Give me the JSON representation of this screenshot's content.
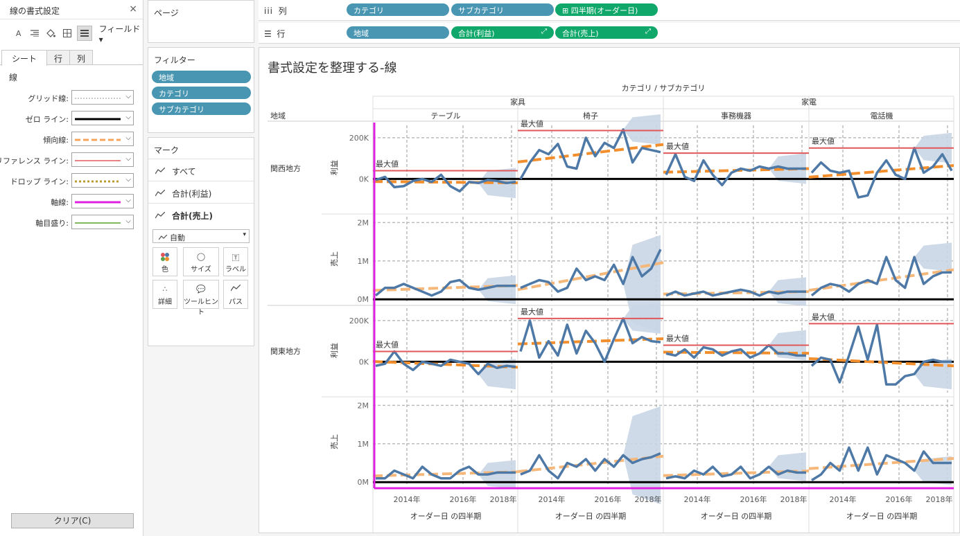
{
  "format_pane": {
    "title": "線の書式設定",
    "close": "×",
    "toolbar_field": "フィールド▾",
    "tabs": [
      {
        "label": "シート",
        "active": true
      },
      {
        "label": "行",
        "active": false
      },
      {
        "label": "列",
        "active": false
      }
    ],
    "section": "線",
    "rows": [
      {
        "label": "グリッド線:",
        "style": "dotted",
        "color": "#bbbbbb"
      },
      {
        "label": "ゼロ ライン:",
        "style": "solid-thick",
        "color": "#000000"
      },
      {
        "label": "傾向線:",
        "style": "dashed",
        "color": "#f5a45d"
      },
      {
        "label": "リファレンス ライン:",
        "style": "solid",
        "color": "#e05a5a"
      },
      {
        "label": "ドロップ ライン:",
        "style": "dotted-thick",
        "color": "#b89b35"
      },
      {
        "label": "軸線:",
        "style": "solid-thick",
        "color": "#e020e0"
      },
      {
        "label": "軸目盛り:",
        "style": "solid",
        "color": "#5aa02c"
      }
    ],
    "clear_button": "クリア(C)"
  },
  "pages": {
    "title": "ページ"
  },
  "filters": {
    "title": "フィルター",
    "items": [
      "地域",
      "カテゴリ",
      "サブカテゴリ"
    ]
  },
  "marks": {
    "title": "マーク",
    "rows": [
      "すべて",
      "合計(利益)",
      "合計(売上)"
    ],
    "type": "自動",
    "buttons": [
      "色",
      "サイズ",
      "ラベル",
      "詳細",
      "ツールヒント",
      "パス"
    ]
  },
  "columns_shelf": {
    "label": "列",
    "pills": [
      "カテゴリ",
      "サブカテゴリ",
      "⊞ 四半期(オーダー日)"
    ]
  },
  "rows_shelf": {
    "label": "行",
    "pills": [
      "地域",
      "合計(利益)",
      "合計(売上)"
    ]
  },
  "viz": {
    "title": "書式設定を整理する-線",
    "col_header_title": "カテゴリ / サブカテゴリ",
    "row_header_title": "地域",
    "categories": [
      "家具",
      "家電"
    ],
    "subcategories": [
      "テーブル",
      "椅子",
      "事務機器",
      "電話機"
    ],
    "regions": [
      "関西地方",
      "関東地方"
    ],
    "measures": [
      "利益",
      "売上"
    ],
    "profit_ticks": [
      "200K",
      "0K"
    ],
    "sales_ticks": [
      "2M",
      "1M",
      "0M"
    ],
    "x_ticks": [
      "2014年",
      "2016年",
      "2018年"
    ],
    "x_title": "オーダー日 の四半期",
    "ref_label": "最大値",
    "colors": {
      "line": "#4e79a7",
      "trend": "#f28e2b",
      "trend_light": "#f5b87a",
      "ref": "#e15759",
      "axis": "#e020e0",
      "band": "#c9d6e6",
      "grid": "#bbbbbb"
    }
  },
  "chart_data": {
    "type": "line",
    "x": [
      "2014年",
      "2016年",
      "2018年"
    ],
    "xlabel": "オーダー日 の四半期",
    "panels": [
      {
        "region": "関西地方",
        "measure": "利益",
        "subcategory": "テーブル",
        "values": [
          -5,
          10,
          -40,
          -35,
          -10,
          0,
          -15,
          20,
          -35,
          -60,
          -15,
          -20,
          -5,
          -10,
          -20,
          -15
        ],
        "reference": 40
      },
      {
        "region": "関西地方",
        "measure": "利益",
        "subcategory": "椅子",
        "values": [
          0,
          80,
          140,
          120,
          170,
          60,
          50,
          200,
          110,
          175,
          150,
          240,
          80,
          150,
          140,
          130
        ],
        "reference": 235
      },
      {
        "region": "関西地方",
        "measure": "利益",
        "subcategory": "事務機器",
        "values": [
          20,
          120,
          10,
          -10,
          90,
          20,
          -30,
          30,
          50,
          40,
          60,
          50,
          60,
          50,
          50,
          50
        ],
        "reference": 125
      },
      {
        "region": "関西地方",
        "measure": "利益",
        "subcategory": "電話機",
        "values": [
          30,
          80,
          40,
          30,
          40,
          -90,
          -80,
          30,
          90,
          20,
          0,
          150,
          30,
          60,
          120,
          40
        ],
        "reference": 150
      },
      {
        "region": "関西地方",
        "measure": "売上",
        "subcategory": "テーブル",
        "values": [
          0.1,
          0.3,
          0.3,
          0.4,
          0.3,
          0.2,
          0.1,
          0.2,
          0.45,
          0.5,
          0.3,
          0.25,
          0.3,
          0.35,
          0.35,
          0.35
        ]
      },
      {
        "region": "関西地方",
        "measure": "売上",
        "subcategory": "椅子",
        "values": [
          0.3,
          0.4,
          0.5,
          0.45,
          0.2,
          0.3,
          0.8,
          0.5,
          0.6,
          0.5,
          0.9,
          0.4,
          1.1,
          0.6,
          0.8,
          1.3
        ]
      },
      {
        "region": "関西地方",
        "measure": "売上",
        "subcategory": "事務機器",
        "values": [
          0.1,
          0.2,
          0.1,
          0.15,
          0.2,
          0.1,
          0.15,
          0.2,
          0.25,
          0.2,
          0.1,
          0.2,
          0.15,
          0.2,
          0.2,
          0.2
        ]
      },
      {
        "region": "関西地方",
        "measure": "売上",
        "subcategory": "電話機",
        "values": [
          0.1,
          0.3,
          0.4,
          0.35,
          0.2,
          0.4,
          0.5,
          0.4,
          1.1,
          0.5,
          0.3,
          1.1,
          0.4,
          0.6,
          0.7,
          0.7
        ]
      },
      {
        "region": "関東地方",
        "measure": "利益",
        "subcategory": "テーブル",
        "values": [
          -20,
          -10,
          50,
          -10,
          -40,
          0,
          -10,
          -20,
          10,
          0,
          -10,
          -60,
          -10,
          -30,
          -20,
          -25
        ],
        "reference": 50
      },
      {
        "region": "関東地方",
        "measure": "利益",
        "subcategory": "椅子",
        "values": [
          50,
          200,
          20,
          100,
          30,
          180,
          40,
          150,
          90,
          0,
          110,
          210,
          90,
          120,
          100,
          95
        ],
        "reference": 210
      },
      {
        "region": "関東地方",
        "measure": "利益",
        "subcategory": "事務機器",
        "values": [
          40,
          30,
          60,
          20,
          70,
          60,
          30,
          50,
          60,
          20,
          40,
          80,
          40,
          40,
          30,
          30
        ],
        "reference": 80
      },
      {
        "region": "関東地方",
        "measure": "利益",
        "subcategory": "電話機",
        "values": [
          -20,
          20,
          10,
          -100,
          30,
          170,
          10,
          180,
          -110,
          -110,
          -70,
          -60,
          0,
          10,
          0,
          0
        ],
        "reference": 185
      },
      {
        "region": "関東地方",
        "measure": "売上",
        "subcategory": "テーブル",
        "values": [
          0.1,
          0.1,
          0.3,
          0.2,
          0.1,
          0.4,
          0.2,
          0.1,
          0.1,
          0.3,
          0.4,
          0.2,
          0.2,
          0.25,
          0.25,
          0.25
        ]
      },
      {
        "region": "関東地方",
        "measure": "売上",
        "subcategory": "椅子",
        "values": [
          0.2,
          0.3,
          0.7,
          0.3,
          0.1,
          0.5,
          0.4,
          0.6,
          0.3,
          0.6,
          0.4,
          0.7,
          0.5,
          0.6,
          0.65,
          0.75
        ]
      },
      {
        "region": "関東地方",
        "measure": "売上",
        "subcategory": "事務機器",
        "values": [
          0.1,
          0.15,
          0.1,
          0.3,
          0.2,
          0.4,
          0.15,
          0.2,
          0.4,
          0.1,
          0.2,
          0.4,
          0.2,
          0.3,
          0.25,
          0.25
        ]
      },
      {
        "region": "関東地方",
        "measure": "売上",
        "subcategory": "電話機",
        "values": [
          0.05,
          0.2,
          0.5,
          0.3,
          0.9,
          0.3,
          0.9,
          0.2,
          0.7,
          0.6,
          0.5,
          0.3,
          0.8,
          0.5,
          0.5,
          0.5
        ]
      }
    ]
  }
}
